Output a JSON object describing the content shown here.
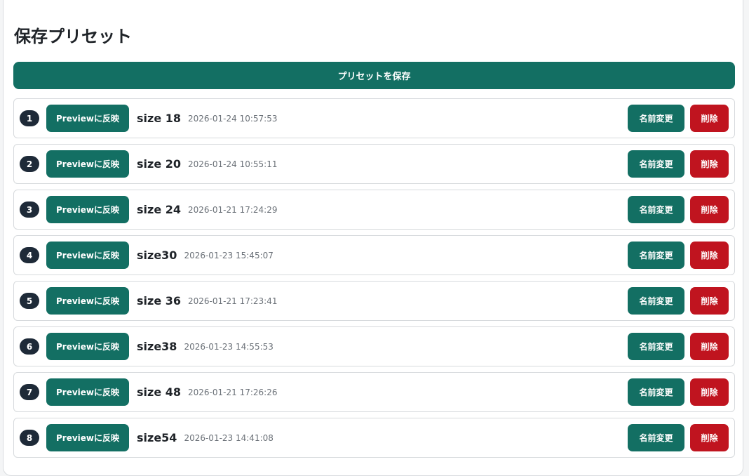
{
  "header": {
    "title": "保存プリセット",
    "save_label": "プリセットを保存"
  },
  "presets": [
    {
      "index": "1",
      "apply_label": "Previewに反映",
      "name": "size 18",
      "date": "2026-01-24 10:57:53",
      "rename_label": "名前変更",
      "delete_label": "削除"
    },
    {
      "index": "2",
      "apply_label": "Previewに反映",
      "name": "size 20",
      "date": "2026-01-24 10:55:11",
      "rename_label": "名前変更",
      "delete_label": "削除"
    },
    {
      "index": "3",
      "apply_label": "Previewに反映",
      "name": "size 24",
      "date": "2026-01-21 17:24:29",
      "rename_label": "名前変更",
      "delete_label": "削除"
    },
    {
      "index": "4",
      "apply_label": "Previewに反映",
      "name": "size30",
      "date": "2026-01-23 15:45:07",
      "rename_label": "名前変更",
      "delete_label": "削除"
    },
    {
      "index": "5",
      "apply_label": "Previewに反映",
      "name": "size 36",
      "date": "2026-01-21 17:23:41",
      "rename_label": "名前変更",
      "delete_label": "削除"
    },
    {
      "index": "6",
      "apply_label": "Previewに反映",
      "name": "size38",
      "date": "2026-01-23 14:55:53",
      "rename_label": "名前変更",
      "delete_label": "削除"
    },
    {
      "index": "7",
      "apply_label": "Previewに反映",
      "name": "size 48",
      "date": "2026-01-21 17:26:26",
      "rename_label": "名前変更",
      "delete_label": "削除"
    },
    {
      "index": "8",
      "apply_label": "Previewに反映",
      "name": "size54",
      "date": "2026-01-23 14:41:08",
      "rename_label": "名前変更",
      "delete_label": "削除"
    }
  ],
  "colors": {
    "primary": "#136f63",
    "danger": "#c0141f",
    "badge": "#1e2a38"
  }
}
